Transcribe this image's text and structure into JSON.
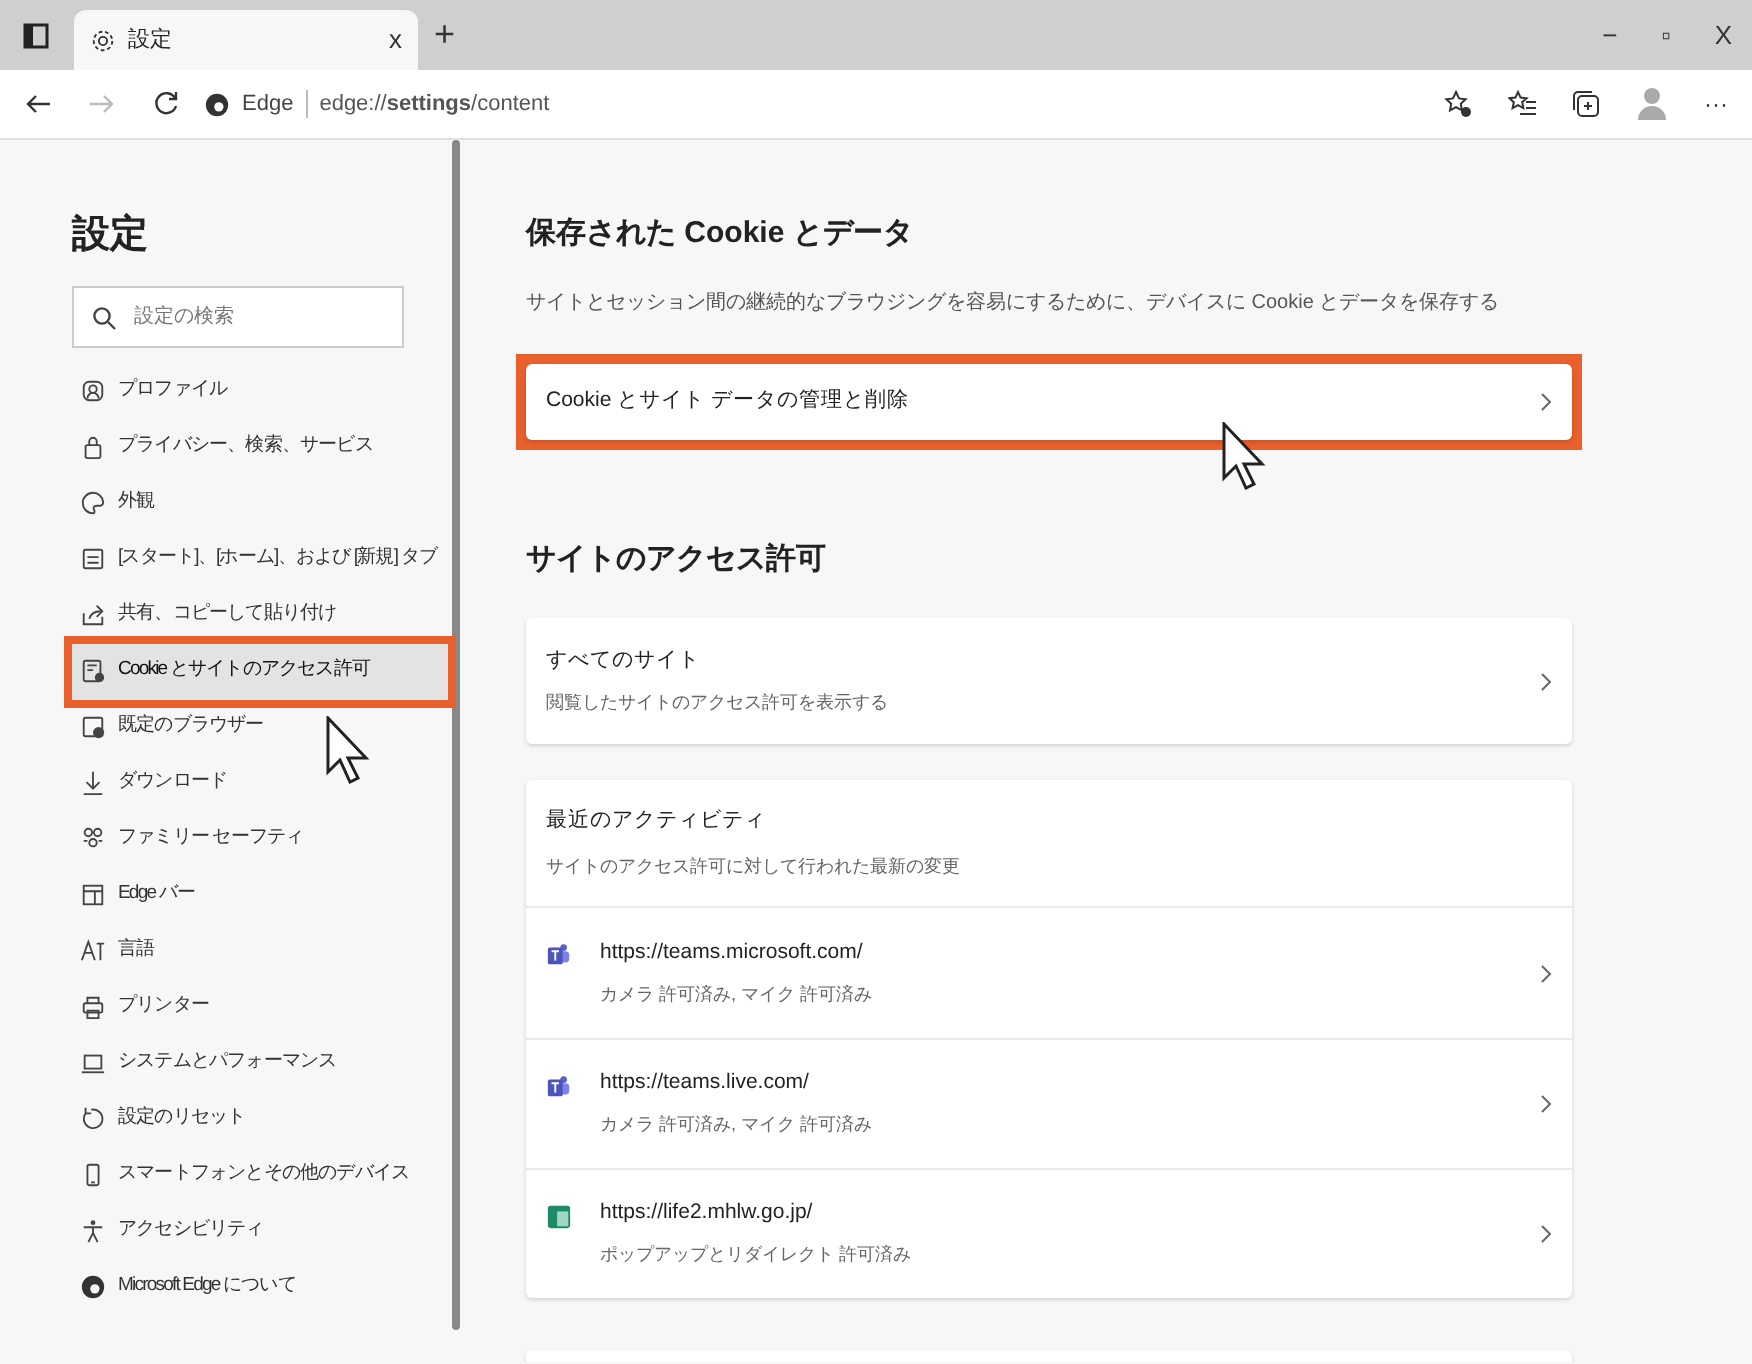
{
  "window": {
    "tab_title": "設定",
    "tab_close": "x",
    "new_tab": "+",
    "controls": [
      "−",
      "▫",
      "X"
    ]
  },
  "address_bar": {
    "site_label": "Edge",
    "url": "edge://**settings**/content",
    "more": "···"
  },
  "sidebar": {
    "title": "設定",
    "search": {
      "placeholder": "設定の検索"
    },
    "items": [
      {
        "label": "プロファイル",
        "selected": false,
        "highlighted": false
      },
      {
        "label": "プライバシー、検索、サービス",
        "selected": false,
        "highlighted": false
      },
      {
        "label": "外観",
        "selected": false,
        "highlighted": false
      },
      {
        "label": "[スタート]、[ホーム]、および [新規] タブ",
        "selected": false,
        "highlighted": false
      },
      {
        "label": "共有、コピーして貼り付け",
        "selected": false,
        "highlighted": false
      },
      {
        "label": "Cookie とサイトのアクセス許可",
        "selected": true,
        "highlighted": true
      },
      {
        "label": "既定のブラウザー",
        "selected": false,
        "highlighted": false
      },
      {
        "label": "ダウンロード",
        "selected": false,
        "highlighted": false
      },
      {
        "label": "ファミリー セーフティ",
        "selected": false,
        "highlighted": false
      },
      {
        "label": "Edge バー",
        "selected": false,
        "highlighted": false
      },
      {
        "label": "言語",
        "selected": false,
        "highlighted": false
      },
      {
        "label": "プリンター",
        "selected": false,
        "highlighted": false
      },
      {
        "label": "システムとパフォーマンス",
        "selected": false,
        "highlighted": false
      },
      {
        "label": "設定のリセット",
        "selected": false,
        "highlighted": false
      },
      {
        "label": "スマートフォンとその他のデバイス",
        "selected": false,
        "highlighted": false
      },
      {
        "label": "アクセシビリティ",
        "selected": false,
        "highlighted": false
      },
      {
        "label": "Microsoft Edge について",
        "selected": false,
        "highlighted": false
      }
    ]
  },
  "cookies_section": {
    "title": "保存された Cookie とデータ",
    "description": "サイトとセッション間の継続的なブラウジングを容易にするために、デバイスに Cookie とデータを保存する",
    "row": {
      "label": "Cookie とサイト データの管理と削除",
      "highlighted": true
    }
  },
  "permissions_section": {
    "title": "サイトのアクセス許可",
    "all_sites": {
      "title": "すべてのサイト",
      "subtitle": "閲覧したサイトのアクセス許可を表示する"
    },
    "recent_activity": {
      "title": "最近のアクティビティ",
      "subtitle": "サイトのアクセス許可に対して行われた最新の変更",
      "sites": [
        {
          "kind": "teams",
          "url": "https://teams.microsoft.com/",
          "detail": "カメラ 許可済み, マイク 許可済み"
        },
        {
          "kind": "teams",
          "url": "https://teams.live.com/",
          "detail": "カメラ 許可済み, マイク 許可済み"
        },
        {
          "kind": "page",
          "url": "https://life2.mhlw.go.jp/",
          "detail": "ポップアップとリダイレクト 許可済み"
        }
      ]
    }
  }
}
